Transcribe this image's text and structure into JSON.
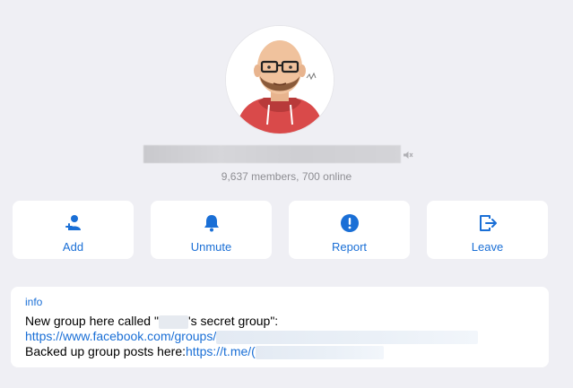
{
  "profile": {
    "subtitle": "9,637 members, 700 online"
  },
  "actions": [
    {
      "label": "Add",
      "icon": "add-user-icon"
    },
    {
      "label": "Unmute",
      "icon": "bell-icon"
    },
    {
      "label": "Report",
      "icon": "exclamation-icon"
    },
    {
      "label": "Leave",
      "icon": "leave-icon"
    }
  ],
  "info": {
    "title": "info",
    "line1_prefix": "New group here called \"",
    "line1_suffix": "'s secret group\":",
    "line2_link": "https://www.facebook.com/groups/",
    "line3_prefix": "Backed up group posts here:",
    "line3_link": "https://t.me/("
  },
  "colors": {
    "accent": "#1a6fd6",
    "background": "#efeff4",
    "card": "#ffffff",
    "muted_text": "#8e8e93"
  }
}
